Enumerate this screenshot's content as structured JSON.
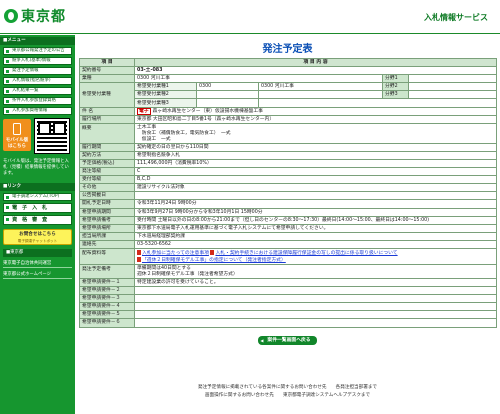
{
  "header": {
    "logo_text": "東京都",
    "system_title": "入札情報サービス"
  },
  "sidebar": {
    "menu_heading": "■メニュー",
    "items": [
      "東京都公報発注予定の公告",
      "競争入札(基本)情報",
      "発注予定情報",
      "入札情報(指名競争)",
      "入札結果一覧",
      "条件入札参加登録資格",
      "入札参加資格情報"
    ],
    "mobile_label": "モバイル版",
    "mobile_sub": "はこちら",
    "mobile_note": "モバイル版は、発注予定情報と入札（見積）結果情報を提供しています。",
    "links_heading": "■リンク",
    "links": [
      "電子調達システム(TOP)",
      "電 子 入 札",
      "資 格 審 査"
    ],
    "vendor_button": "お問合せはこちら",
    "vendor_sub": "電子調達チャットボット",
    "tokyo_heading": "■東京都",
    "tokyo_links": [
      "東京電子自治体共同運営",
      "東京都公式ホームページ"
    ]
  },
  "main": {
    "page_title": "発注予定表",
    "table_header": [
      "項 目",
      "項 目 内 容"
    ],
    "contract_no_label": "契約番号",
    "contract_no": "03-土-083",
    "gyoshu_label": "業種",
    "gyoshu_value": "0300 河川工事",
    "kibou_label": "希望受付業種",
    "kibou_rows": [
      {
        "label": "希望受付業種1",
        "code": "0300",
        "value": "0300 河川工事"
      },
      {
        "label": "希望受付業種2",
        "code": "",
        "value": ""
      },
      {
        "label": "希望受付業種3",
        "code": "",
        "value": ""
      }
    ],
    "bunya_labels": [
      "分野1",
      "分野2",
      "分野3"
    ],
    "kenmei_label": "件 名",
    "kenmei_tag": "電子",
    "kenmei_value": "森ヶ崎水再生センター（東）仮設揚水機棟基盤工事",
    "place_label": "履行場所",
    "place_value": "東京都 大田区昭和島二丁目5番1号（森ヶ崎水再生センター内）",
    "gaiyo_label": "概要",
    "gaiyo_lines": [
      "土木工事",
      "　防食工（補償防食工，電気防食工）　一式",
      "　仮設工　一式"
    ],
    "period_label": "履行期間",
    "period_value": "契約確定の日の翌日から110日間",
    "method_label": "契約方法",
    "method_value": "希望制指名競争入札",
    "price_label": "予定価格(税込)",
    "price_value": "111,496,000円（消費税率10%）",
    "grade_label": "発注等級",
    "grade_value": "C",
    "accept_grade_label": "受付等級",
    "accept_grade_value": "B,C,D",
    "other_label": "その他",
    "other_value": "建設リサイクル法対象",
    "koukoku_label": "公告掲載日",
    "koukoku_value": "",
    "open_label": "開札予定日時",
    "open_value": "令和3年11月24日 9時00分",
    "entry_period_label": "希望申請期間",
    "entry_period_value": "令和3年9月27日 9時00分から令和3年10月1日 15時00分",
    "entry_note_label": "希望申請備考",
    "entry_note_value": "受付時間 土曜日以外の日の8:00から21:00まで（但し日のセンターの8:30～17:30）最終日(14:00～15:00、最終日は14:00～15:00)",
    "entry_where_label": "希望申請場所",
    "entry_where_value": "東京都下水道局電子入札運用基準に基づく電子入札システムにて希望申請してください。",
    "dept_label": "担当局所課",
    "dept_value": "下水道局経理部契約課",
    "tel_label": "連絡先",
    "tel_value": "03-5320-6562",
    "docs_label": "配布資料等",
    "docs": [
      "入札参加に当たっての注意事項",
      "入札・契約手続きにおける建設保障履行保証金の写しの提出に係る取り扱いについて",
      "「週休２日制確保モデル工事」の指定について（発注者指定方式）"
    ],
    "order_note_label": "発注予定備考",
    "order_note_lines": [
      "準備期間は40日間とする",
      "週休２日制確保モデル工事（発注者希望方式）"
    ],
    "cond1_label": "希望申請要件－１",
    "cond1_value": "特定建設業の許可を受けていること。",
    "cond_labels": [
      "希望申請要件－２",
      "希望申請要件－３",
      "希望申請要件－４",
      "希望申請要件－５",
      "希望申請要件－６"
    ],
    "back_button": "案件一覧画面へ戻る"
  },
  "footer": {
    "line1": "発注予定情報に掲載されている各案件に関するお問い合わせ先　　各発注担当部署まで",
    "line2": "画面操作に関するお問い合わせ先　　東京都電子調達システムヘルプデスクまで"
  }
}
